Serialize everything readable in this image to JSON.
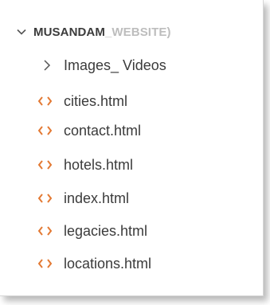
{
  "explorer": {
    "folder_name_main": "MUSANDAM",
    "folder_name_faded": "_WEBSITE)",
    "root_icon": "chevron-down-icon",
    "items": [
      {
        "label": "Images_ Videos",
        "type": "folder",
        "icon": "chevron-right-icon"
      },
      {
        "label": "cities.html",
        "type": "file",
        "icon": "html-code-icon"
      },
      {
        "label": "contact.html",
        "type": "file",
        "icon": "html-code-icon"
      },
      {
        "label": "hotels.html",
        "type": "file",
        "icon": "html-code-icon"
      },
      {
        "label": "index.html",
        "type": "file",
        "icon": "html-code-icon"
      },
      {
        "label": "legacies.html",
        "type": "file",
        "icon": "html-code-icon"
      },
      {
        "label": "locations.html",
        "type": "file",
        "icon": "html-code-icon"
      }
    ]
  },
  "colors": {
    "text": "#3b3b3b",
    "faded_text": "#bdbdbd",
    "html_icon": "#e37933"
  }
}
